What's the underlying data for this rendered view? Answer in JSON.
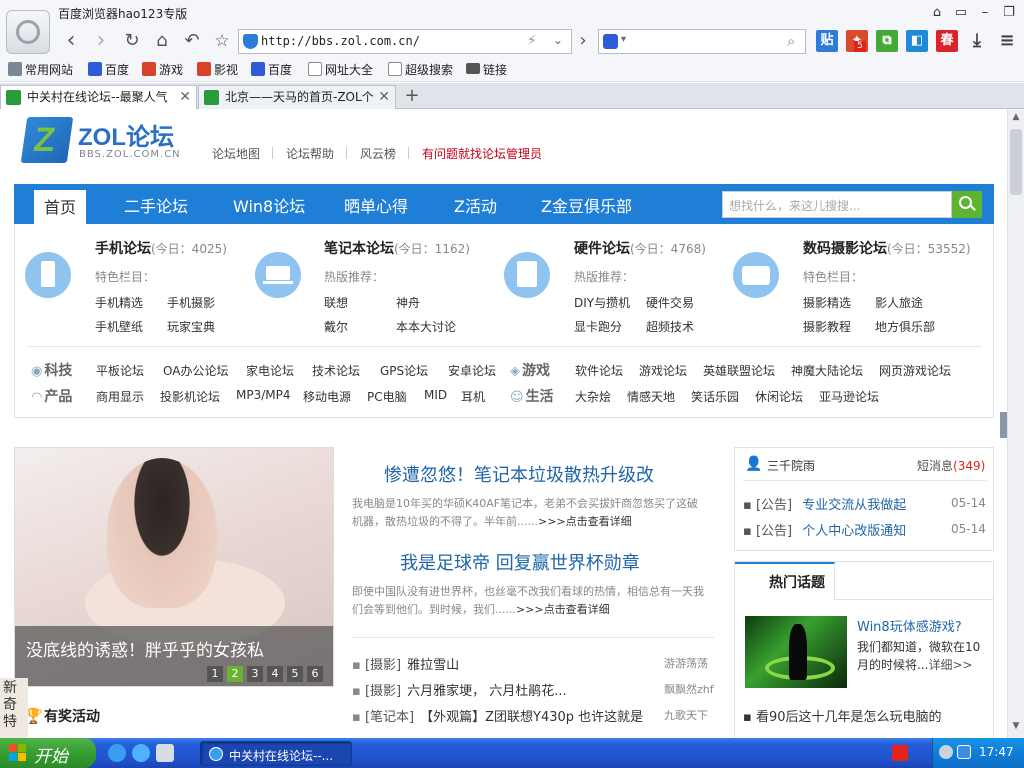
{
  "window": {
    "title": "百度浏览器hao123专版"
  },
  "nav": {
    "url": "http://bbs.zol.com.cn/",
    "search_engine_icon": "paw-icon"
  },
  "bookmarks": [
    {
      "label": "常用网站",
      "icon": "grid-icon",
      "color": "#7a8796"
    },
    {
      "label": "百度",
      "icon": "paw-icon",
      "color": "#2f5bd8"
    },
    {
      "label": "游戏",
      "icon": "hao-icon",
      "color": "#d9412a"
    },
    {
      "label": "影视",
      "icon": "hao-icon",
      "color": "#d9412a"
    },
    {
      "label": "百度",
      "icon": "paw-icon",
      "color": "#2f5bd8"
    },
    {
      "label": "网址大全",
      "icon": "page-icon",
      "color": "#8a8a8a"
    },
    {
      "label": "超级搜索",
      "icon": "page-icon",
      "color": "#8a8a8a"
    },
    {
      "label": "链接",
      "icon": "folder-icon",
      "color": "#555555"
    }
  ],
  "tabs": [
    {
      "label": "中关村在线论坛--最聚人气"
    },
    {
      "label": "北京——天马的首页-ZOL个"
    }
  ],
  "site": {
    "brand": "ZOL论坛",
    "brand_sub": "BBS.ZOL.COM.CN",
    "top_links": [
      "论坛地图",
      "论坛帮助",
      "风云榜"
    ],
    "top_link_red": "有问题就找论坛管理员",
    "main_nav": [
      "首页",
      "二手论坛",
      "Win8论坛",
      "晒单心得",
      "Z活动",
      "Z金豆俱乐部"
    ],
    "search_placeholder": "想找什么，来这儿搜搜..."
  },
  "forums": [
    {
      "name": "手机论坛",
      "count": "(今日：4025)",
      "tag": "特色栏目：",
      "links": [
        "手机精选",
        "手机摄影",
        "手机壁纸",
        "玩家宝典"
      ]
    },
    {
      "name": "笔记本论坛",
      "count": "(今日：1162)",
      "tag": "热版推荐：",
      "links": [
        "联想",
        "神舟",
        "戴尔",
        "本本大讨论"
      ]
    },
    {
      "name": "硬件论坛",
      "count": "(今日：4768)",
      "tag": "热版推荐：",
      "links": [
        "DIY与攒机",
        "硬件交易",
        "显卡跑分",
        "超频技术"
      ]
    },
    {
      "name": "数码摄影论坛",
      "count": "(今日：53552)",
      "tag": "特色栏目：",
      "links": [
        "摄影精选",
        "影人旅途",
        "摄影教程",
        "地方俱乐部"
      ]
    }
  ],
  "categories": {
    "tech": {
      "label": "科技",
      "links": [
        "平板论坛",
        "OA办公论坛",
        "家电论坛",
        "技术论坛",
        "GPS论坛",
        "安卓论坛"
      ]
    },
    "game": {
      "label": "游戏",
      "links": [
        "软件论坛",
        "游戏论坛",
        "英雄联盟论坛",
        "神魔大陆论坛",
        "网页游戏论坛"
      ]
    },
    "product": {
      "label": "产品",
      "links": [
        "商用显示",
        "投影机论坛",
        "MP3/MP4",
        "移动电源",
        "PC电脑",
        "MID",
        "耳机"
      ]
    },
    "life": {
      "label": "生活",
      "links": [
        "大杂烩",
        "情感天地",
        "笑话乐园",
        "休闲论坛",
        "亚马逊论坛"
      ]
    }
  },
  "hero": {
    "caption": "没底线的诱惑！胖乎乎的女孩私",
    "pages": [
      "1",
      "2",
      "3",
      "4",
      "5",
      "6"
    ],
    "active_page": "2"
  },
  "articles": [
    {
      "title": "惨遭忽悠！笔记本垃圾散热升级改",
      "desc": "我电脑是10年买的华硕K40AF笔记本，老弟不会买拔奸商忽悠买了这破机器，散热垃圾的不得了。半年前......",
      "more": ">>>点击查看详细"
    },
    {
      "title": "我是足球帝 回复赢世界杯勋章",
      "desc": "即使中国队没有进世界杯，也丝毫不改我们看球的热情，相信总有一天我们会等到他们。到时候，我们......",
      "more": ">>>点击查看详细"
    }
  ],
  "posts": [
    {
      "section": "[摄影]",
      "title": "雅拉雪山",
      "author": "游游荡荡"
    },
    {
      "section": "[摄影]",
      "title": "六月雅家埂， 六月杜鹃花...",
      "author": "飘飘然zhf"
    },
    {
      "section": "[笔记本]",
      "title": "【外观篇】Z团联想Y430p 也许这就是",
      "author": "九歌天下"
    }
  ],
  "user": {
    "name": "三千院雨",
    "msg_label": "短消息",
    "msg_count": "(349)",
    "notices": [
      {
        "tag": "[公告]",
        "text": "专业交流从我做起",
        "date": "05-14"
      },
      {
        "tag": "[公告]",
        "text": "个人中心改版通知",
        "date": "05-14"
      }
    ]
  },
  "hot": {
    "tab": "热门话题",
    "title": "Win8玩体感游戏?",
    "desc": "我们都知道，微软在10月的时候将...",
    "more": "详细>>",
    "list": [
      "看90后这十几年是怎么玩电脑的"
    ]
  },
  "activity": {
    "label": "有奖活动"
  },
  "side_widget": {
    "text": "新奇特"
  },
  "taskbar": {
    "start": "开始",
    "item": "中关村在线论坛--...",
    "clock": "17:47"
  }
}
